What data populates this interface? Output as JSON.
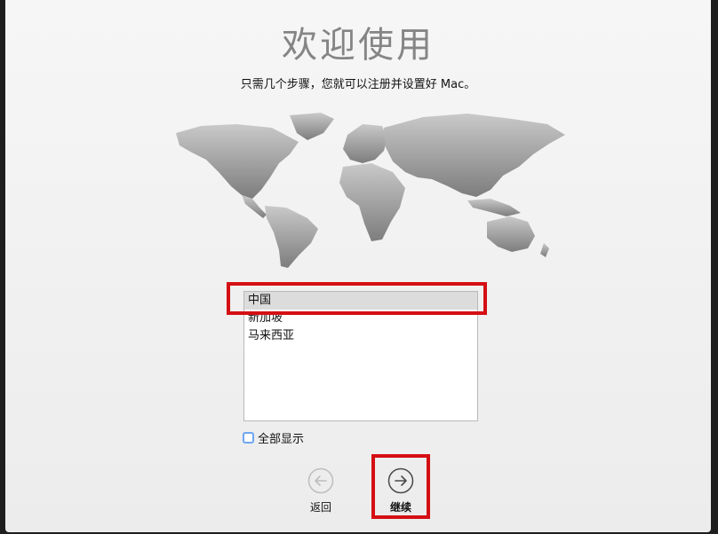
{
  "title": "欢迎使用",
  "subtitle": "只需几个步骤，您就可以注册并设置好 Mac。",
  "region_list": {
    "items": [
      {
        "label": "中国",
        "selected": true
      },
      {
        "label": "新加坡",
        "selected": false
      },
      {
        "label": "马来西亚",
        "selected": false
      }
    ]
  },
  "show_all": {
    "label": "全部显示",
    "checked": false
  },
  "nav": {
    "back_label": "返回",
    "back_icon": "arrow-left-circle-icon",
    "continue_label": "继续",
    "continue_icon": "arrow-right-circle-icon"
  },
  "colors": {
    "accent_highlight": "#d40f14",
    "checkbox_border": "#6fa6f2",
    "map_fill": "#8a8a8a"
  }
}
